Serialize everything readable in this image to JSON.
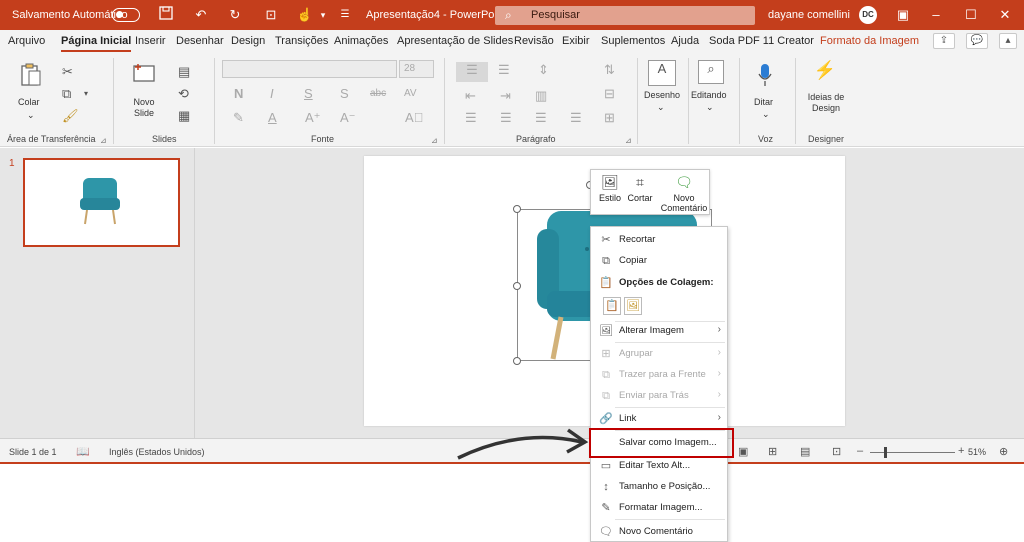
{
  "titlebar": {
    "autosave_label": "Salvamento Automático",
    "doc_title": "Apresentação4  -  PowerPoint",
    "search_placeholder": "Pesquisar",
    "user_name": "dayane comellini",
    "avatar_initials": "DC",
    "quick_access_icons": [
      "save-icon",
      "undo-icon",
      "redo-icon",
      "present-icon",
      "touch-mode-icon",
      "customize-icon"
    ],
    "window_buttons": [
      "ribbon-display-icon",
      "minimize-icon",
      "maximize-icon",
      "close-icon"
    ]
  },
  "menu": {
    "tabs": [
      "Arquivo",
      "Página Inicial",
      "Inserir",
      "Desenhar",
      "Design",
      "Transições",
      "Animações",
      "Apresentação de Slides",
      "Revisão",
      "Exibir",
      "Suplementos",
      "Ajuda",
      "Soda PDF 11 Creator",
      "Formato da Imagem"
    ],
    "active": "Página Inicial",
    "context_tab": "Formato da Imagem"
  },
  "ribbon": {
    "clipboard": {
      "paste": "Colar",
      "label": "Área de Transferência"
    },
    "slides": {
      "new_slide": "Novo Slide",
      "label": "Slides"
    },
    "font": {
      "label": "Fonte",
      "font_size": "28",
      "bold": "N",
      "italic": "I",
      "underline": "S",
      "shadow": "S",
      "strike": "abc",
      "spacing": "AV",
      "font_color": "A"
    },
    "paragraph": {
      "label": "Parágrafo"
    },
    "drawing": {
      "label": "Desenho"
    },
    "editing": {
      "label": "Editando"
    },
    "voice": {
      "dictate": "Ditar",
      "label": "Voz"
    },
    "designer": {
      "ideas": "Ideias de Design",
      "label": "Designer"
    }
  },
  "slides_pane": {
    "slide_number": "1"
  },
  "mini_toolbar": {
    "style": "Estilo",
    "crop": "Cortar",
    "comment": "Novo Comentário"
  },
  "context_menu": {
    "cut": "Recortar",
    "copy": "Copiar",
    "paste_options": "Opções de Colagem:",
    "change_image": "Alterar Imagem",
    "group": "Agrupar",
    "bring_front": "Trazer para a Frente",
    "send_back": "Enviar para Trás",
    "link": "Link",
    "save_as_image": "Salvar como Imagem...",
    "edit_alt_text": "Editar Texto Alt...",
    "size_position": "Tamanho e Posição...",
    "format_image": "Formatar Imagem...",
    "new_comment": "Novo Comentário"
  },
  "statusbar": {
    "slide_info": "Slide 1 de 1",
    "language": "Inglês (Estados Unidos)",
    "zoom": "51%"
  },
  "colors": {
    "brand": "#c43e1c",
    "highlight": "#c00000",
    "chair": "#2e96a8"
  }
}
